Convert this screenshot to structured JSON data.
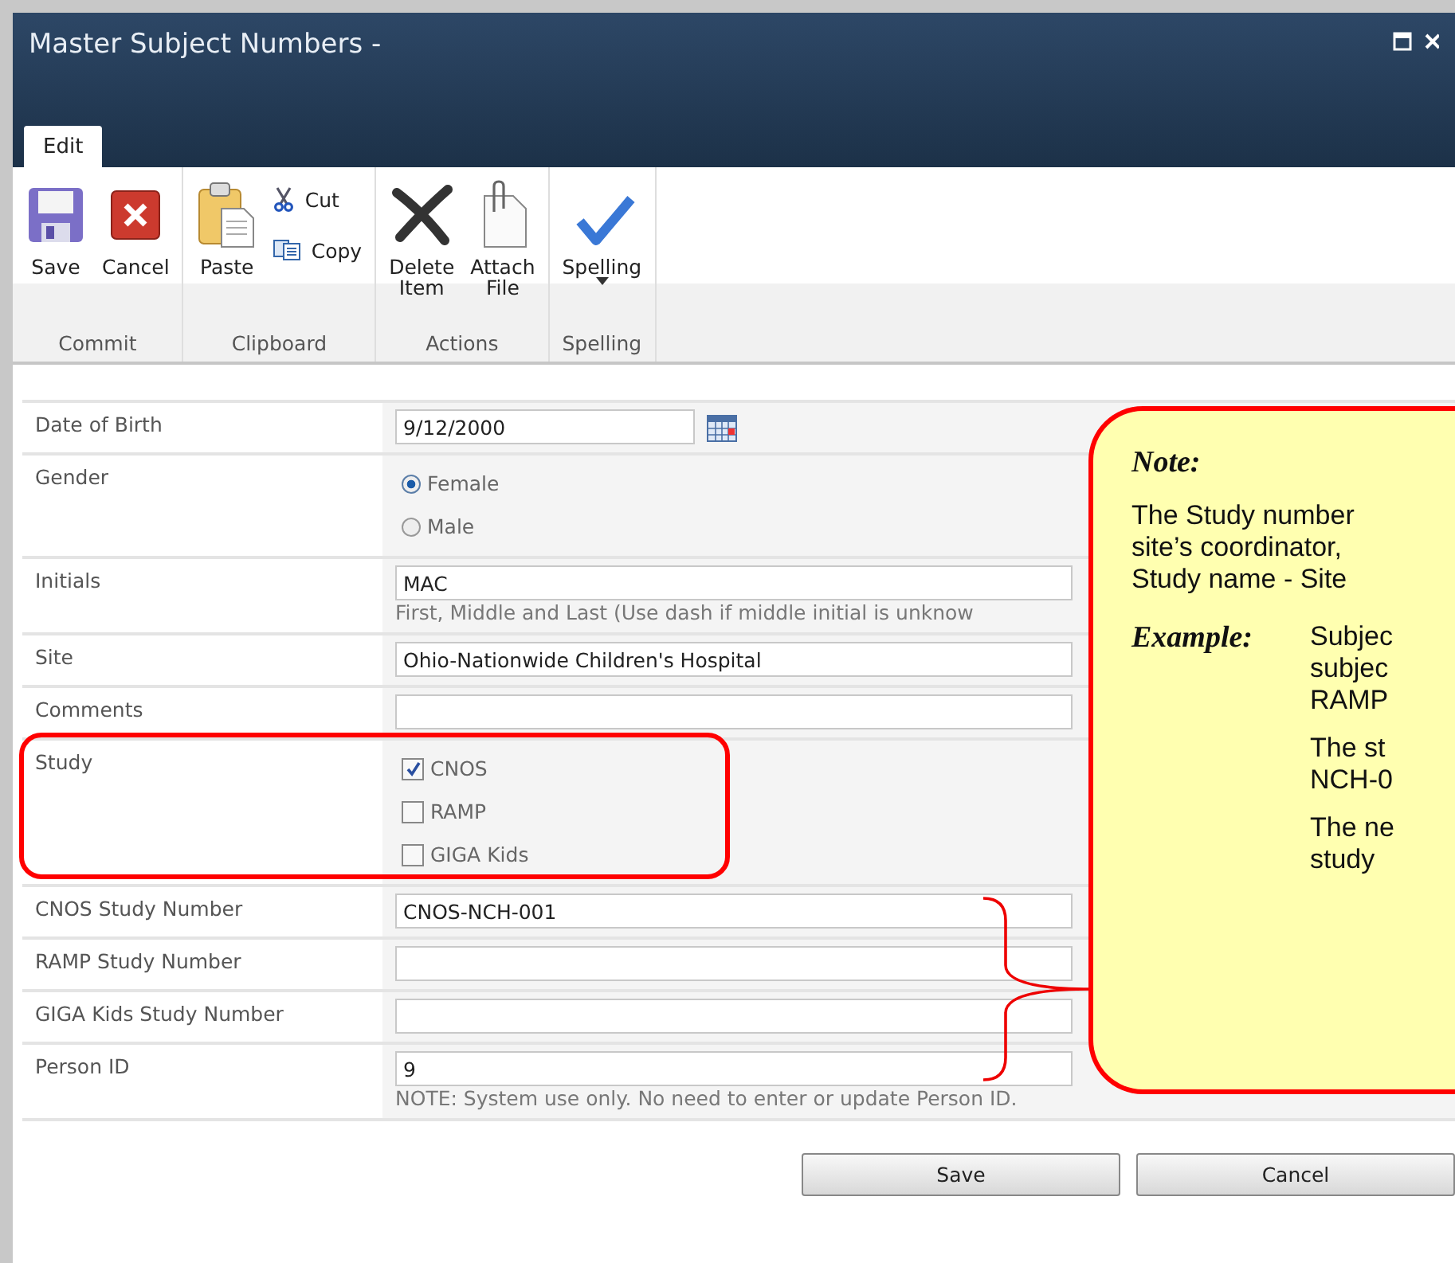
{
  "window": {
    "title": "Master Subject Numbers -"
  },
  "ribbon": {
    "tabs": [
      {
        "label": "Edit",
        "selected": true
      }
    ],
    "groups": [
      {
        "label": "Commit",
        "items": [
          {
            "kind": "save",
            "label": "Save"
          },
          {
            "kind": "cancel",
            "label": "Cancel"
          }
        ]
      },
      {
        "label": "Clipboard",
        "items": [
          {
            "kind": "paste",
            "label": "Paste"
          },
          {
            "kind": "cutcopy",
            "label": "Cut",
            "label2": "Copy"
          }
        ]
      },
      {
        "label": "Actions",
        "items": [
          {
            "kind": "delete",
            "label": "Delete\nItem"
          },
          {
            "kind": "attach",
            "label": "Attach\nFile"
          }
        ]
      },
      {
        "label": "Spelling",
        "items": [
          {
            "kind": "spelling",
            "label": "Spelling"
          }
        ]
      }
    ]
  },
  "form": {
    "rows": [
      {
        "kind": "date",
        "label": "Date of Birth",
        "value": "9/12/2000"
      },
      {
        "kind": "radio",
        "label": "Gender",
        "options": [
          {
            "label": "Female",
            "selected": true
          },
          {
            "label": "Male",
            "selected": false
          }
        ]
      },
      {
        "kind": "text",
        "label": "Initials",
        "value": "MAC",
        "hint": "First, Middle and Last (Use dash if middle initial is unknow"
      },
      {
        "kind": "text",
        "label": "Site",
        "value": "Ohio-Nationwide Children's Hospital"
      },
      {
        "kind": "text",
        "label": "Comments",
        "value": ""
      },
      {
        "kind": "checkbox",
        "label": "Study",
        "highlighted": true,
        "options": [
          {
            "label": "CNOS",
            "checked": true
          },
          {
            "label": "RAMP",
            "checked": false
          },
          {
            "label": "GIGA Kids",
            "checked": false
          }
        ]
      },
      {
        "kind": "text",
        "label": "CNOS Study Number",
        "value": "CNOS-NCH-001"
      },
      {
        "kind": "text",
        "label": "RAMP Study Number",
        "value": ""
      },
      {
        "kind": "text",
        "label": "GIGA Kids Study Number",
        "value": ""
      },
      {
        "kind": "text",
        "label": "Person ID",
        "value": "9",
        "hint": "NOTE: System use only. No need to enter or update Person ID."
      }
    ]
  },
  "callout": {
    "title": "Note:",
    "intro": [
      "The Study number",
      "site’s coordinator,",
      "Study name - Site"
    ],
    "example_label": "Example:",
    "paragraphs": [
      [
        "Subjec",
        "subjec",
        "RAMP"
      ],
      [
        "The st",
        "NCH-0"
      ],
      [
        "The ne",
        "study"
      ]
    ]
  },
  "buttons": [
    "Save",
    "Cancel"
  ]
}
